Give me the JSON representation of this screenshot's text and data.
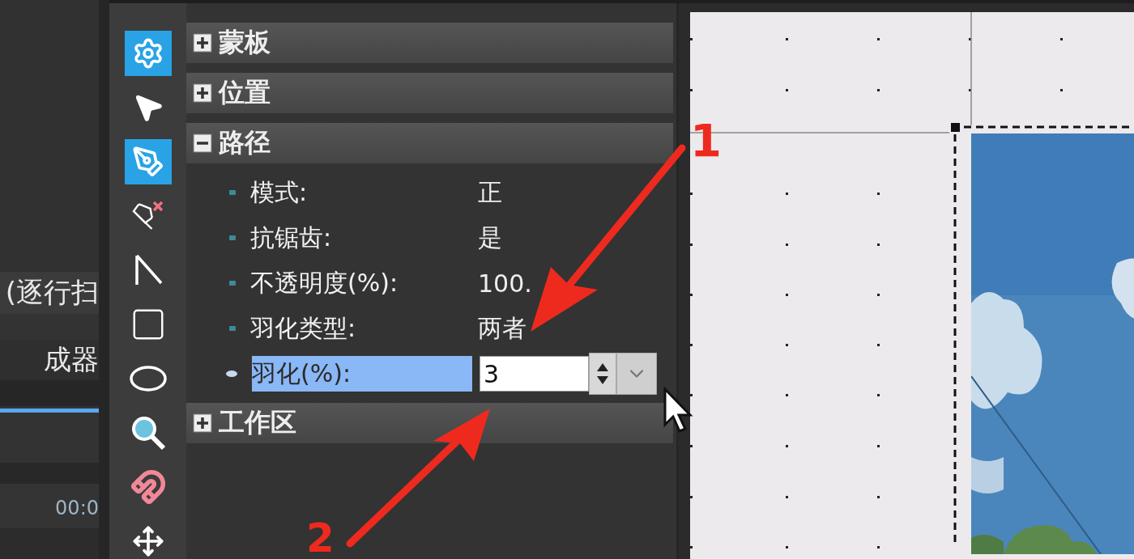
{
  "left_panel": {
    "row_1": "(逐行扫",
    "row_2": "成器",
    "timecode": "00:0"
  },
  "toolbar": {
    "tools": [
      {
        "kind": "gear",
        "selected": true
      },
      {
        "kind": "pointer",
        "selected": false
      },
      {
        "kind": "pen",
        "selected": true
      },
      {
        "kind": "pen-delete",
        "selected": false
      },
      {
        "kind": "angle",
        "selected": false
      },
      {
        "kind": "rectangle",
        "selected": false
      },
      {
        "kind": "ellipse",
        "selected": false
      },
      {
        "kind": "zoom",
        "selected": false
      },
      {
        "kind": "magnet",
        "selected": false
      },
      {
        "kind": "move",
        "selected": false
      }
    ]
  },
  "sections": [
    {
      "title": "蒙板",
      "expanded": false
    },
    {
      "title": "位置",
      "expanded": false
    },
    {
      "title": "路径",
      "expanded": true,
      "properties": [
        {
          "label": "模式:",
          "value": "正",
          "selected": false,
          "kind": "text"
        },
        {
          "label": "抗锯齿:",
          "value": "是",
          "selected": false,
          "kind": "text"
        },
        {
          "label": "不透明度(%):",
          "value": "100.",
          "selected": false,
          "kind": "text"
        },
        {
          "label": "羽化类型:",
          "value": "两者",
          "selected": false,
          "kind": "text"
        },
        {
          "label": "羽化(%):",
          "value": "3",
          "selected": true,
          "kind": "spinner"
        }
      ]
    },
    {
      "title": "工作区",
      "expanded": false
    }
  ],
  "annotations": [
    {
      "label": "1"
    },
    {
      "label": "2"
    }
  ]
}
